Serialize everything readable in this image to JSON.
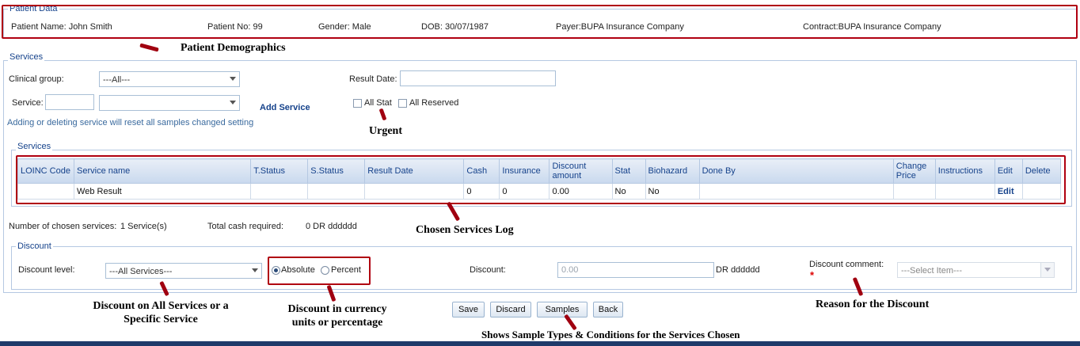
{
  "patient": {
    "legend": "Patient Data",
    "name": "Patient Name: John Smith",
    "number": "Patient No: 99",
    "gender": "Gender: Male",
    "dob": "DOB: 30/07/1987",
    "payer": "Payer:BUPA Insurance Company",
    "contract": "Contract:BUPA Insurance Company"
  },
  "services_form": {
    "legend": "Services",
    "clinical_group_label": "Clinical group:",
    "clinical_group_value": "---All---",
    "result_date_label": "Result Date:",
    "result_date_value": "",
    "service_label": "Service:",
    "service_code_value": "",
    "service_select_value": "",
    "add_service_label": "Add Service",
    "all_stat_label": "All Stat",
    "all_reserved_label": "All Reserved",
    "hint": "Adding or deleting service will reset all samples changed setting"
  },
  "grid": {
    "legend": "Services",
    "columns": [
      "LOINC Code",
      "Service name",
      "T.Status",
      "S.Status",
      "Result Date",
      "Cash",
      "Insurance",
      "Discount amount",
      "Stat",
      "Biohazard",
      "Done By",
      "Change Price",
      "Instructions",
      "Edit",
      "Delete"
    ],
    "rows": [
      [
        "",
        "Web Result",
        "",
        "",
        "",
        "0",
        "0",
        "0.00",
        "No",
        "No",
        "",
        "",
        "",
        "Edit",
        ""
      ]
    ]
  },
  "summary": {
    "chosen_label": "Number of chosen services:",
    "chosen_value": "1 Service(s)",
    "cash_label": "Total cash required:",
    "cash_value": "0 DR dddddd"
  },
  "discount": {
    "legend": "Discount",
    "level_label": "Discount level:",
    "level_value": "---All Services---",
    "absolute_label": "Absolute",
    "percent_label": "Percent",
    "discount_label": "Discount:",
    "discount_value": "0.00",
    "currency": "DR dddddd",
    "comment_label": "Discount comment:",
    "required_mark": "*",
    "comment_value": "---Select Item---"
  },
  "buttons": {
    "save": "Save",
    "discard": "Discard",
    "samples": "Samples",
    "back": "Back"
  },
  "annotations": {
    "demographics": "Patient Demographics",
    "urgent": "Urgent",
    "log": "Chosen Services Log",
    "discount_scope": "Discount on All Services or a Specific Service",
    "discount_units": "Discount in currency units or percentage",
    "reason": "Reason for the Discount",
    "samples": "Shows Sample Types & Conditions for the Services Chosen"
  },
  "colors": {
    "accent": "#15428b",
    "annotation_box": "#b00010",
    "footer_bar": "#1f3a6a"
  }
}
